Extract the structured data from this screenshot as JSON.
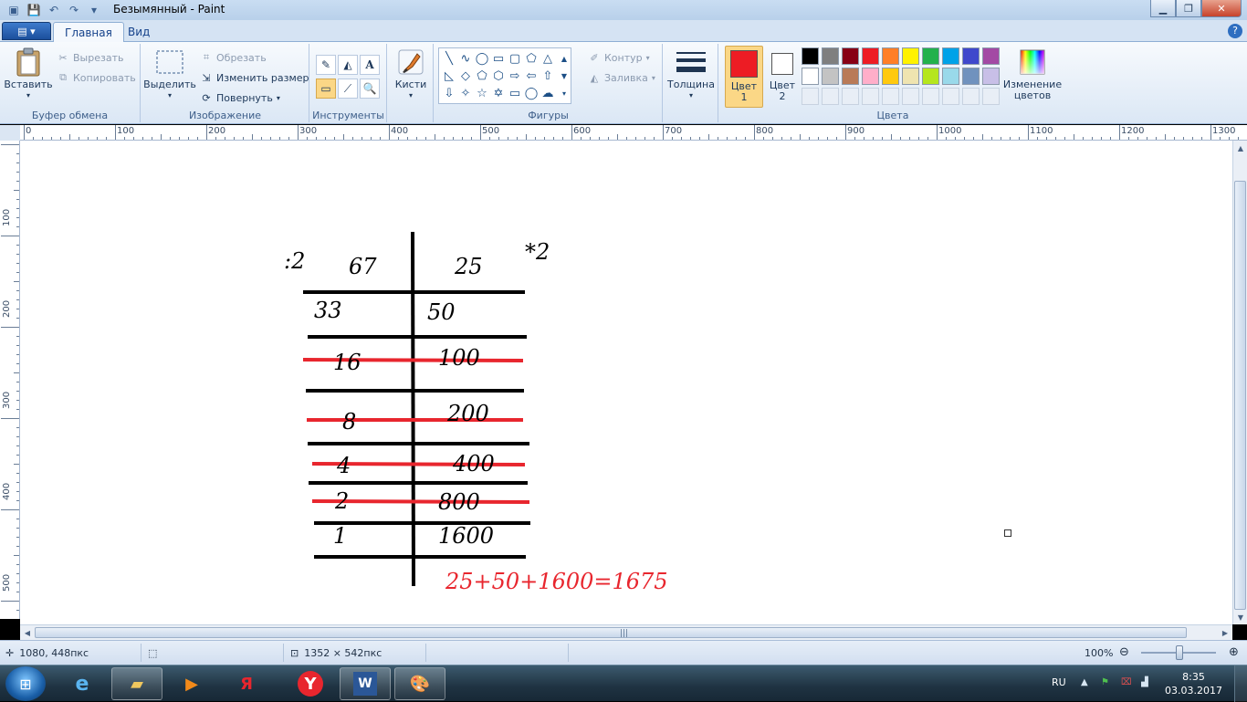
{
  "window": {
    "title": "Безымянный - Paint"
  },
  "tabs": [
    {
      "label": "Главная"
    },
    {
      "label": "Вид"
    }
  ],
  "ribbon": {
    "clipboard": {
      "paste": "Вставить",
      "cut": "Вырезать",
      "copy": "Копировать",
      "group": "Буфер обмена"
    },
    "image": {
      "select": "Выделить",
      "crop": "Обрезать",
      "resize": "Изменить размер",
      "rotate": "Повернуть",
      "group": "Изображение"
    },
    "tools": {
      "group": "Инструменты"
    },
    "brushes": {
      "label": "Кисти"
    },
    "shapes": {
      "outline": "Контур",
      "fill": "Заливка",
      "group": "Фигуры"
    },
    "size": {
      "label": "Толщина"
    },
    "colors": {
      "color1_label": "Цвет\n1",
      "color2_label": "Цвет\n2",
      "color1_value": "#ed1c24",
      "color2_value": "#ffffff",
      "edit": "Изменение\nцветов",
      "group": "Цвета",
      "palette_row1": [
        "#000000",
        "#7f7f7f",
        "#880015",
        "#ed1c24",
        "#ff7f27",
        "#fff200",
        "#22b14c",
        "#00a2e8",
        "#3f48cc",
        "#a349a4"
      ],
      "palette_row2": [
        "#ffffff",
        "#c3c3c3",
        "#b97a57",
        "#ffaec9",
        "#ffc90e",
        "#efe4b0",
        "#b5e61d",
        "#99d9ea",
        "#7092be",
        "#c8bfe7"
      ]
    }
  },
  "ruler": {
    "top": [
      "0",
      "100",
      "200",
      "300",
      "400",
      "500",
      "600",
      "700",
      "800",
      "900",
      "1000",
      "1100",
      "1200",
      "1300"
    ],
    "left": [
      "100",
      "200",
      "300",
      "400",
      "500"
    ]
  },
  "drawing": {
    "left_op": ":2",
    "right_op": "*2",
    "left_col": [
      "67",
      "33",
      "16",
      "8",
      "4",
      "2",
      "1"
    ],
    "right_col": [
      "25",
      "50",
      "100",
      "200",
      "400",
      "800",
      "1600"
    ],
    "result": "25+50+1600=1675"
  },
  "status": {
    "cursor": "1080, 448пкс",
    "size": "1352 × 542пкс",
    "zoom": "100%"
  },
  "taskbar": {
    "lang": "RU",
    "time": "8:35",
    "date": "03.03.2017"
  }
}
